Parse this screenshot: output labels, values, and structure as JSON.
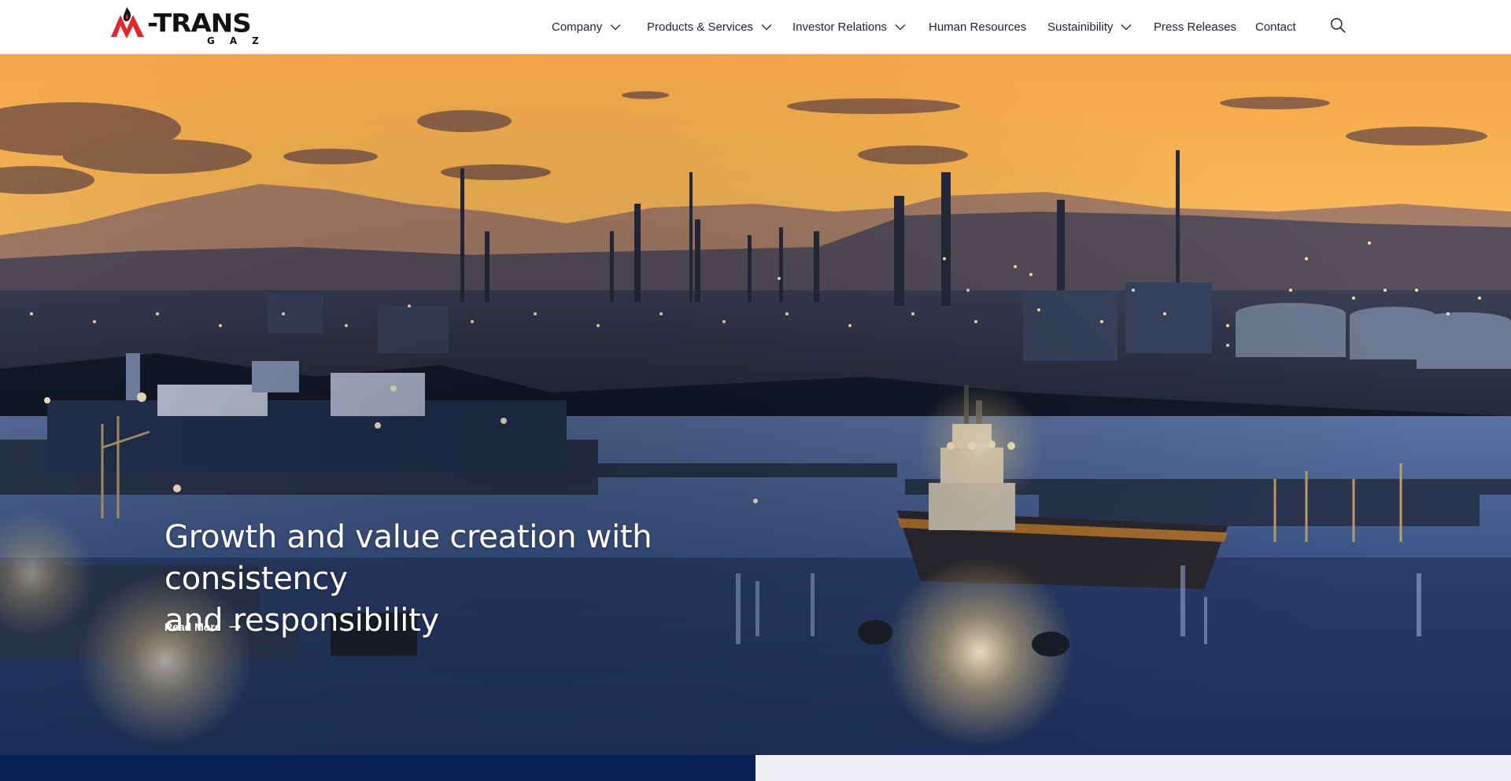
{
  "brand": {
    "name": "-TRANS",
    "sub": "GAZ",
    "mark_color": "#e3262e",
    "text_color": "#111111"
  },
  "nav": {
    "items": [
      {
        "label": "Company",
        "has_dropdown": true
      },
      {
        "label": "Products & Services",
        "has_dropdown": true
      },
      {
        "label": "Investor Relations",
        "has_dropdown": true
      },
      {
        "label": "Human Resources",
        "has_dropdown": false
      },
      {
        "label": "Sustainibility",
        "has_dropdown": true
      },
      {
        "label": "Press Releases",
        "has_dropdown": false
      },
      {
        "label": "Contact",
        "has_dropdown": false
      }
    ],
    "search_icon": "search-icon"
  },
  "hero": {
    "title_line1": "Growth and value creation with consistency",
    "title_line2": "and responsibility",
    "read_more": "Read More",
    "arrow_icon": "arrow-right-icon"
  },
  "colors": {
    "navy": "#062353",
    "light_panel": "#eef0f6",
    "nav_text": "#1f2330"
  }
}
